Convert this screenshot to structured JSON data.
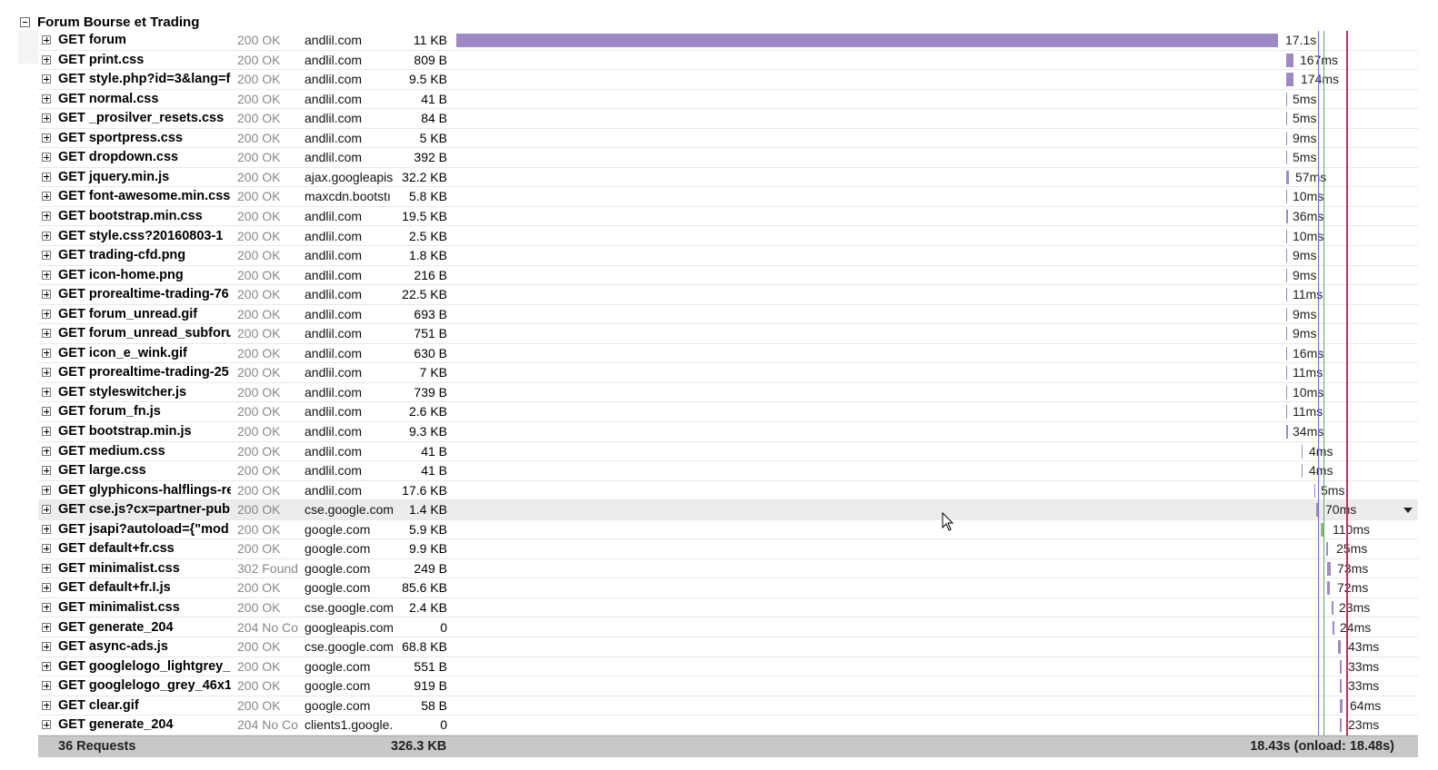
{
  "group": {
    "title": "Forum Bourse et Trading"
  },
  "requests": [
    {
      "url": "GET forum",
      "status": "200 OK",
      "domain": "andlil.com",
      "size": "11 KB",
      "time": "17.1s"
    },
    {
      "url": "GET print.css",
      "status": "200 OK",
      "domain": "andlil.com",
      "size": "809 B",
      "time": "167ms"
    },
    {
      "url": "GET style.php?id=3&lang=f",
      "status": "200 OK",
      "domain": "andlil.com",
      "size": "9.5 KB",
      "time": "174ms"
    },
    {
      "url": "GET normal.css",
      "status": "200 OK",
      "domain": "andlil.com",
      "size": "41 B",
      "time": "5ms"
    },
    {
      "url": "GET _prosilver_resets.css",
      "status": "200 OK",
      "domain": "andlil.com",
      "size": "84 B",
      "time": "5ms"
    },
    {
      "url": "GET sportpress.css",
      "status": "200 OK",
      "domain": "andlil.com",
      "size": "5 KB",
      "time": "9ms"
    },
    {
      "url": "GET dropdown.css",
      "status": "200 OK",
      "domain": "andlil.com",
      "size": "392 B",
      "time": "5ms"
    },
    {
      "url": "GET jquery.min.js",
      "status": "200 OK",
      "domain": "ajax.googleapis.",
      "size": "32.2 KB",
      "time": "57ms"
    },
    {
      "url": "GET font-awesome.min.css",
      "status": "200 OK",
      "domain": "maxcdn.bootstı",
      "size": "5.8 KB",
      "time": "10ms"
    },
    {
      "url": "GET bootstrap.min.css",
      "status": "200 OK",
      "domain": "andlil.com",
      "size": "19.5 KB",
      "time": "36ms"
    },
    {
      "url": "GET style.css?20160803-1",
      "status": "200 OK",
      "domain": "andlil.com",
      "size": "2.5 KB",
      "time": "10ms"
    },
    {
      "url": "GET trading-cfd.png",
      "status": "200 OK",
      "domain": "andlil.com",
      "size": "1.8 KB",
      "time": "9ms"
    },
    {
      "url": "GET icon-home.png",
      "status": "200 OK",
      "domain": "andlil.com",
      "size": "216 B",
      "time": "9ms"
    },
    {
      "url": "GET prorealtime-trading-76",
      "status": "200 OK",
      "domain": "andlil.com",
      "size": "22.5 KB",
      "time": "11ms"
    },
    {
      "url": "GET forum_unread.gif",
      "status": "200 OK",
      "domain": "andlil.com",
      "size": "693 B",
      "time": "9ms"
    },
    {
      "url": "GET forum_unread_subforu",
      "status": "200 OK",
      "domain": "andlil.com",
      "size": "751 B",
      "time": "9ms"
    },
    {
      "url": "GET icon_e_wink.gif",
      "status": "200 OK",
      "domain": "andlil.com",
      "size": "630 B",
      "time": "16ms"
    },
    {
      "url": "GET prorealtime-trading-25",
      "status": "200 OK",
      "domain": "andlil.com",
      "size": "7 KB",
      "time": "11ms"
    },
    {
      "url": "GET styleswitcher.js",
      "status": "200 OK",
      "domain": "andlil.com",
      "size": "739 B",
      "time": "10ms"
    },
    {
      "url": "GET forum_fn.js",
      "status": "200 OK",
      "domain": "andlil.com",
      "size": "2.6 KB",
      "time": "11ms"
    },
    {
      "url": "GET bootstrap.min.js",
      "status": "200 OK",
      "domain": "andlil.com",
      "size": "9.3 KB",
      "time": "34ms"
    },
    {
      "url": "GET medium.css",
      "status": "200 OK",
      "domain": "andlil.com",
      "size": "41 B",
      "time": "4ms"
    },
    {
      "url": "GET large.css",
      "status": "200 OK",
      "domain": "andlil.com",
      "size": "41 B",
      "time": "4ms"
    },
    {
      "url": "GET glyphicons-halflings-reg",
      "status": "200 OK",
      "domain": "andlil.com",
      "size": "17.6 KB",
      "time": "5ms"
    },
    {
      "url": "GET cse.js?cx=partner-pub",
      "status": "200 OK",
      "domain": "cse.google.com",
      "size": "1.4 KB",
      "time": "70ms"
    },
    {
      "url": "GET jsapi?autoload={\"mod",
      "status": "200 OK",
      "domain": "google.com",
      "size": "5.9 KB",
      "time": "110ms"
    },
    {
      "url": "GET default+fr.css",
      "status": "200 OK",
      "domain": "google.com",
      "size": "9.9 KB",
      "time": "25ms"
    },
    {
      "url": "GET minimalist.css",
      "status": "302 Found",
      "domain": "google.com",
      "size": "249 B",
      "time": "73ms"
    },
    {
      "url": "GET default+fr.I.js",
      "status": "200 OK",
      "domain": "google.com",
      "size": "85.6 KB",
      "time": "72ms"
    },
    {
      "url": "GET minimalist.css",
      "status": "200 OK",
      "domain": "cse.google.com",
      "size": "2.4 KB",
      "time": "23ms"
    },
    {
      "url": "GET generate_204",
      "status": "204 No Co",
      "domain": "googleapis.com",
      "size": "0",
      "time": "24ms"
    },
    {
      "url": "GET async-ads.js",
      "status": "200 OK",
      "domain": "cse.google.com",
      "size": "68.8 KB",
      "time": "43ms"
    },
    {
      "url": "GET googlelogo_lightgrey_",
      "status": "200 OK",
      "domain": "google.com",
      "size": "551 B",
      "time": "33ms"
    },
    {
      "url": "GET googlelogo_grey_46x1",
      "status": "200 OK",
      "domain": "google.com",
      "size": "919 B",
      "time": "33ms"
    },
    {
      "url": "GET clear.gif",
      "status": "200 OK",
      "domain": "google.com",
      "size": "58 B",
      "time": "64ms"
    },
    {
      "url": "GET generate_204",
      "status": "204 No Co",
      "domain": "clients1.google.",
      "size": "0",
      "time": "23ms"
    }
  ],
  "summary": {
    "count": "36 Requests",
    "total_size": "326.3 KB",
    "timing": "18.43s (onload: 18.48s)"
  },
  "colors": {
    "bar": "#9c89c6",
    "bar_green": "#8fb86a",
    "dom_line": "#6a6af0",
    "green_line": "#5fa85f",
    "onload_line": "#c0306a"
  },
  "icons": {
    "collapse": "minus-box-icon",
    "expand": "plus-box-icon",
    "dropdown": "chevron-down-icon",
    "cursor": "mouse-pointer-icon"
  }
}
